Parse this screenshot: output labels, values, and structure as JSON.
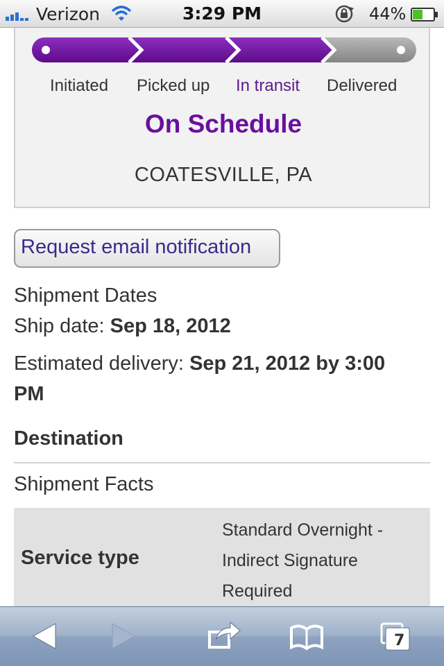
{
  "status_bar": {
    "carrier": "Verizon",
    "time": "3:29 PM",
    "battery": "44%",
    "signal_icon": "signal-bars-icon",
    "wifi_icon": "wifi-icon",
    "lock_icon": "rotation-lock-icon",
    "battery_icon": "battery-icon"
  },
  "tracking": {
    "progress_steps_completed": 3,
    "progress_steps_total": 4,
    "steps": [
      {
        "label": "Initiated",
        "active": false
      },
      {
        "label": "Picked up",
        "active": false
      },
      {
        "label": "In transit",
        "active": true
      },
      {
        "label": "Delivered",
        "active": false
      }
    ],
    "status": "On Schedule",
    "location": "COATESVILLE, PA",
    "colors": {
      "progress": "#6d0f9c",
      "remaining": "#9a9a9a",
      "status": "#6a0fa0"
    }
  },
  "email_button": "Request email notification",
  "dates": {
    "heading": "Shipment Dates",
    "ship_label": "Ship date:",
    "ship_value": "Sep 18, 2012",
    "delivery_label": "Estimated delivery:",
    "delivery_value_line1": "Sep 21, 2012 by 3:00",
    "delivery_value_line2": "PM"
  },
  "destination": {
    "heading": "Destination"
  },
  "facts": {
    "heading": "Shipment Facts",
    "rows": [
      {
        "label": "Service type",
        "value_lines": [
          "Standard Overnight -",
          "Indirect Signature",
          "Required"
        ]
      }
    ]
  },
  "toolbar": {
    "tab_count": "7",
    "buttons": [
      "back-icon",
      "forward-icon",
      "share-icon",
      "bookmarks-icon",
      "tabs-icon"
    ]
  }
}
